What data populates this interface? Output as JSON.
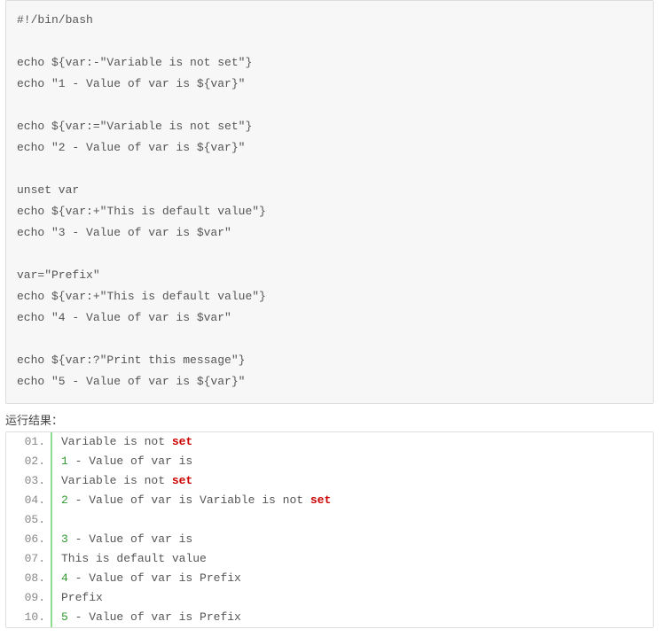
{
  "code": {
    "lines": [
      "#!/bin/bash",
      "",
      "echo ${var:-\"Variable is not set\"}",
      "echo \"1 - Value of var is ${var}\"",
      "",
      "echo ${var:=\"Variable is not set\"}",
      "echo \"2 - Value of var is ${var}\"",
      "",
      "unset var",
      "echo ${var:+\"This is default value\"}",
      "echo \"3 - Value of var is $var\"",
      "",
      "var=\"Prefix\"",
      "echo ${var:+\"This is default value\"}",
      "echo \"4 - Value of var is $var\"",
      "",
      "echo ${var:?\"Print this message\"}",
      "echo \"5 - Value of var is ${var}\""
    ]
  },
  "section_title": "运行结果：",
  "result": {
    "rows": [
      {
        "n": "01.",
        "segments": [
          {
            "t": "Variable is not ",
            "c": ""
          },
          {
            "t": "set",
            "c": "kw"
          }
        ]
      },
      {
        "n": "02.",
        "segments": [
          {
            "t": "1",
            "c": "num"
          },
          {
            "t": " - Value of var is",
            "c": ""
          }
        ]
      },
      {
        "n": "03.",
        "segments": [
          {
            "t": "Variable is not ",
            "c": ""
          },
          {
            "t": "set",
            "c": "kw"
          }
        ]
      },
      {
        "n": "04.",
        "segments": [
          {
            "t": "2",
            "c": "num"
          },
          {
            "t": " - Value of var is Variable is not ",
            "c": ""
          },
          {
            "t": "set",
            "c": "kw"
          }
        ]
      },
      {
        "n": "05.",
        "segments": []
      },
      {
        "n": "06.",
        "segments": [
          {
            "t": "3",
            "c": "num"
          },
          {
            "t": " - Value of var is",
            "c": ""
          }
        ]
      },
      {
        "n": "07.",
        "segments": [
          {
            "t": "This is default value",
            "c": ""
          }
        ]
      },
      {
        "n": "08.",
        "segments": [
          {
            "t": "4",
            "c": "num"
          },
          {
            "t": " - Value of var is Prefix",
            "c": ""
          }
        ]
      },
      {
        "n": "09.",
        "segments": [
          {
            "t": "Prefix",
            "c": ""
          }
        ]
      },
      {
        "n": "10.",
        "segments": [
          {
            "t": "5",
            "c": "num"
          },
          {
            "t": " - Value of var is Prefix",
            "c": ""
          }
        ]
      }
    ]
  }
}
